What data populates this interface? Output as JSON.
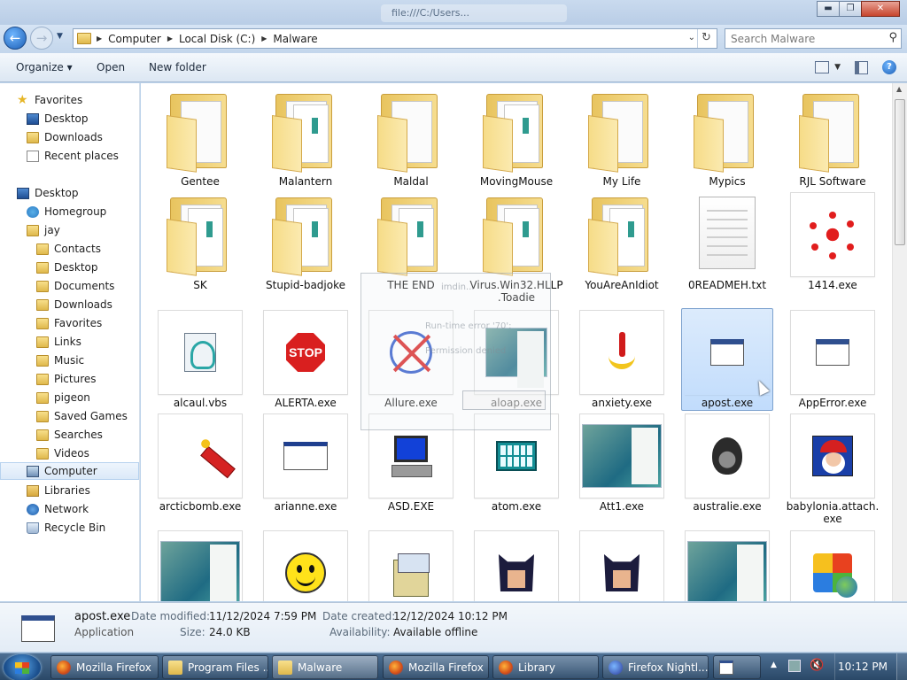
{
  "window": {
    "caption": "file:///C:/Users..."
  },
  "titlebar": {
    "min": "▬",
    "max": "❐",
    "close": "✕"
  },
  "address": {
    "crumbs": [
      "Computer",
      "Local Disk (C:)",
      "Malware"
    ],
    "search_placeholder": "Search Malware"
  },
  "commands": {
    "organize": "Organize ▾",
    "open": "Open",
    "new_folder": "New folder"
  },
  "nav": {
    "favorites": {
      "label": "Favorites",
      "items": [
        "Desktop",
        "Downloads",
        "Recent places"
      ]
    },
    "desktop": "Desktop",
    "homegroup": "Homegroup",
    "user": "jay",
    "user_items": [
      "Contacts",
      "Desktop",
      "Documents",
      "Downloads",
      "Favorites",
      "Links",
      "Music",
      "Pictures",
      "pigeon",
      "Saved Games",
      "Searches",
      "Videos"
    ],
    "computer": "Computer",
    "libraries": "Libraries",
    "network": "Network",
    "recycle": "Recycle Bin"
  },
  "files": {
    "row1": [
      "Gentee",
      "Malantern",
      "Maldal",
      "MovingMouse",
      "My Life",
      "Mypics",
      "RJL Software"
    ],
    "row2": [
      "SK",
      "Stupid-badjoke",
      "THE END",
      "Virus.Win32.HLLP.Toadie",
      "YouAreAnIdiot",
      "0READMEH.txt",
      "1414.exe"
    ],
    "row3": [
      "alcaul.vbs",
      "ALERTA.exe",
      "Allure.exe",
      "aloap.exe",
      "anxiety.exe",
      "apost.exe",
      "AppError.exe"
    ],
    "row4": [
      "arcticbomb.exe",
      "arianne.exe",
      "ASD.EXE",
      "atom.exe",
      "Att1.exe",
      "australie.exe",
      "babylonia.attach.exe"
    ],
    "toadie_line1": "Virus.Win32.HLLP",
    "toadie_line2": ".Toadie",
    "baby_line1": "babylonia.attach.",
    "baby_line2": "exe",
    "stop_text": "STOP"
  },
  "overlay": {
    "title": "imdin...",
    "line1": "Run-time error '70':",
    "line2": "Permission denied"
  },
  "details": {
    "name": "apost.exe",
    "type": "Application",
    "date_modified_label": "Date modified:",
    "date_modified": "11/12/2024 7:59 PM",
    "size_label": "Size:",
    "size": "24.0 KB",
    "date_created_label": "Date created:",
    "date_created": "12/12/2024 10:12 PM",
    "availability_label": "Availability:",
    "availability": "Available offline"
  },
  "taskbar": {
    "items": [
      "Mozilla Firefox",
      "Program Files ...",
      "Malware",
      "Mozilla Firefox",
      "Library",
      "Firefox Nightl..."
    ],
    "clock": "10:12 PM"
  },
  "colors": {
    "selection": "#c1dcfc",
    "taskbar": "#2a4867",
    "accent": "#1d5fb5"
  }
}
